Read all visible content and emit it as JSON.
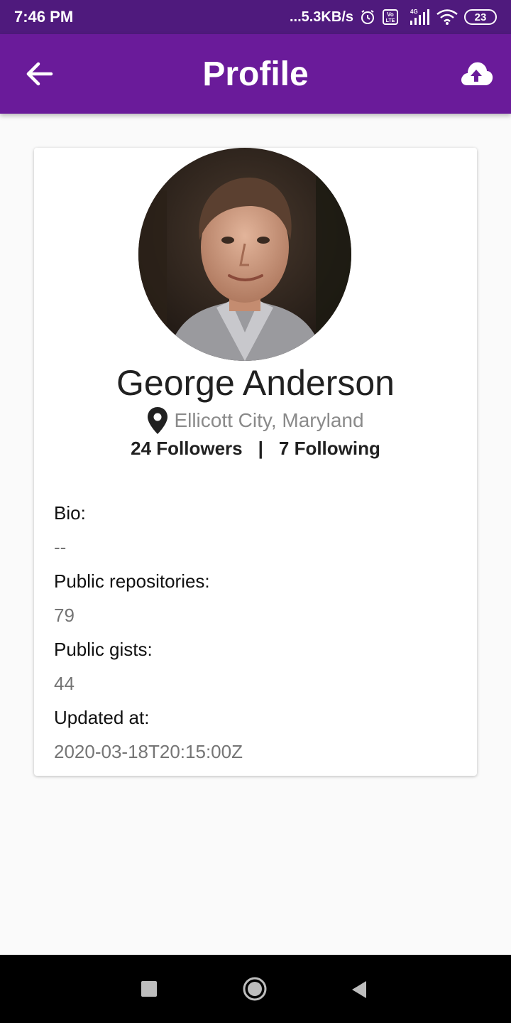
{
  "status_bar": {
    "time": "7:46 PM",
    "network_speed": "...5.3KB/s",
    "volte": "Vo LTE",
    "network_type": "4G",
    "battery": "23"
  },
  "app_bar": {
    "title": "Profile",
    "back_icon": "arrow-left-icon",
    "upload_icon": "cloud-upload-icon"
  },
  "profile": {
    "name": "George Anderson",
    "location": "Ellicott City, Maryland",
    "followers": "24 Followers",
    "separator": "|",
    "following": "7 Following"
  },
  "details": {
    "bio_label": "Bio:",
    "bio_value": "--",
    "repos_label": "Public repositories:",
    "repos_value": "79",
    "gists_label": "Public gists:",
    "gists_value": "44",
    "updated_label": "Updated at:",
    "updated_value": "2020-03-18T20:15:00Z"
  },
  "nav_bar": {
    "recents_icon": "square-icon",
    "home_icon": "circle-icon",
    "back_icon": "triangle-back-icon"
  },
  "colors": {
    "status_bar": "#4f1a7d",
    "app_bar": "#6a1b9a",
    "background": "#fafafa"
  }
}
